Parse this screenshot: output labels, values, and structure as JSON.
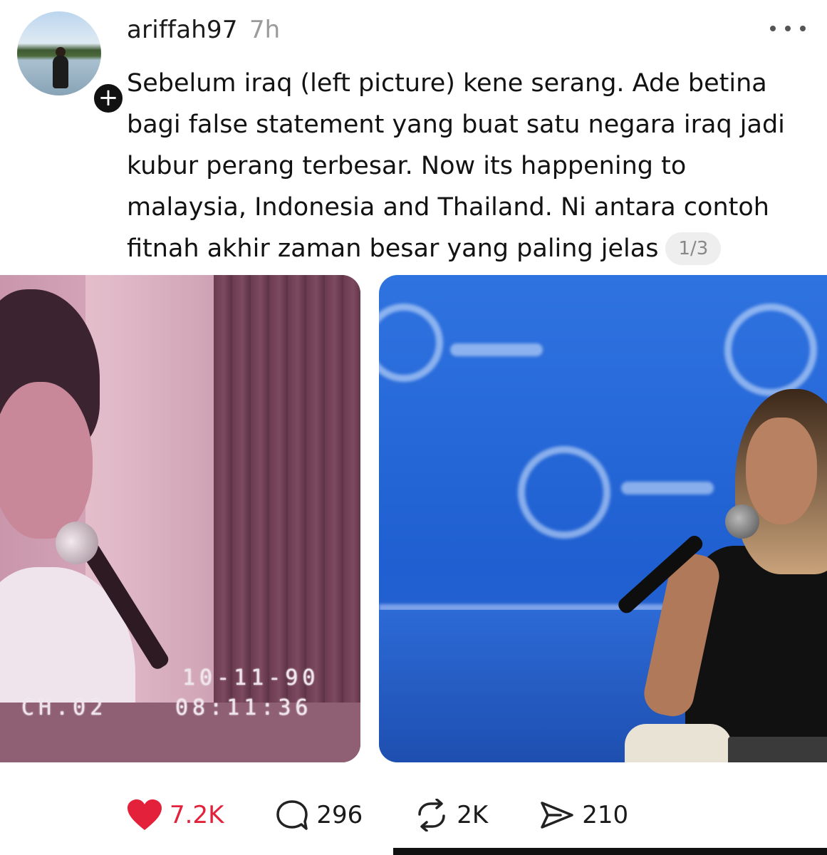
{
  "post": {
    "username": "ariffah97",
    "time": "7h",
    "follow_label": "+",
    "text": "Sebelum iraq (left picture) kene serang. Ade betina bagi false statement yang buat satu negara iraq jadi kubur perang terbesar. Now its happening to malaysia, Indonesia and Thailand. Ni antara contoh fitnah akhir zaman besar yang paling jelas",
    "page_indicator": "1/3"
  },
  "media": {
    "left_image": {
      "overlay_date": "10-11-90",
      "overlay_time": "08:11:36",
      "overlay_channel": "CH.02"
    }
  },
  "actions": {
    "likes": "7.2K",
    "comments": "296",
    "reposts": "2K",
    "shares": "210"
  },
  "colors": {
    "like_red": "#e3213b",
    "text": "#121212",
    "muted": "#9a9a9a"
  },
  "icons": {
    "avatar": "avatar",
    "follow": "plus-icon",
    "more": "more-dots-icon",
    "like": "heart-icon",
    "comment": "comment-bubble-icon",
    "repost": "repost-icon",
    "share": "send-icon"
  }
}
